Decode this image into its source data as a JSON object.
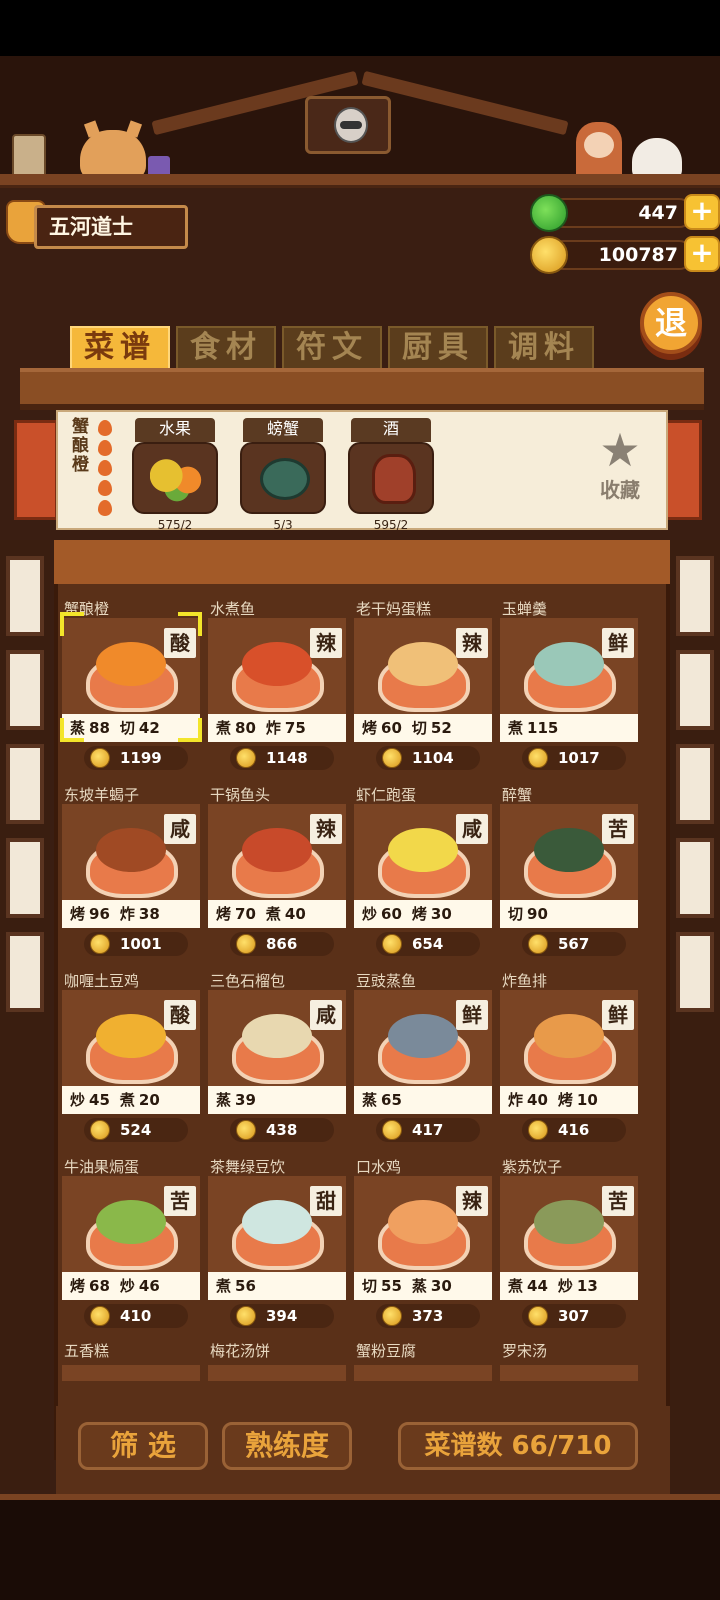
{
  "player": {
    "name": "五河道士"
  },
  "currency": {
    "gems": "447",
    "coins": "100787",
    "plus": "+"
  },
  "exit_label": "退",
  "tabs": [
    {
      "label": "菜谱",
      "active": true
    },
    {
      "label": "食材",
      "active": false
    },
    {
      "label": "符文",
      "active": false
    },
    {
      "label": "厨具",
      "active": false
    },
    {
      "label": "调料",
      "active": false
    }
  ],
  "selected_dish": {
    "name": "蟹酿橙",
    "ingredients": [
      {
        "label": "水果",
        "count": "575/2",
        "icon": "fruit-icon"
      },
      {
        "label": "螃蟹",
        "count": "5/3",
        "icon": "crab-icon"
      },
      {
        "label": "酒",
        "count": "595/2",
        "icon": "wine-jar-icon"
      }
    ],
    "favorite_label": "收藏",
    "favorite_icon": "star-icon"
  },
  "recipes": [
    {
      "name": "蟹酿橙",
      "taste": "酸",
      "skills": [
        [
          "蒸",
          "88"
        ],
        [
          "切",
          "42"
        ]
      ],
      "price": "1199",
      "color": "#f08a2a"
    },
    {
      "name": "水煮鱼",
      "taste": "辣",
      "skills": [
        [
          "煮",
          "80"
        ],
        [
          "炸",
          "75"
        ]
      ],
      "price": "1148",
      "color": "#d8502a"
    },
    {
      "name": "老干妈蛋糕",
      "taste": "辣",
      "skills": [
        [
          "烤",
          "60"
        ],
        [
          "切",
          "52"
        ]
      ],
      "price": "1104",
      "color": "#f0c078"
    },
    {
      "name": "玉蝉羹",
      "taste": "鲜",
      "skills": [
        [
          "煮",
          "115"
        ]
      ],
      "price": "1017",
      "color": "#9ac8b8"
    },
    {
      "name": "东坡羊蝎子",
      "taste": "咸",
      "skills": [
        [
          "烤",
          "96"
        ],
        [
          "炸",
          "38"
        ]
      ],
      "price": "1001",
      "color": "#a04a24"
    },
    {
      "name": "干锅鱼头",
      "taste": "辣",
      "skills": [
        [
          "烤",
          "70"
        ],
        [
          "煮",
          "40"
        ]
      ],
      "price": "866",
      "color": "#c84a2a"
    },
    {
      "name": "虾仁跑蛋",
      "taste": "咸",
      "skills": [
        [
          "炒",
          "60"
        ],
        [
          "烤",
          "30"
        ]
      ],
      "price": "654",
      "color": "#f2d84a"
    },
    {
      "name": "醉蟹",
      "taste": "苦",
      "skills": [
        [
          "切",
          "90"
        ]
      ],
      "price": "567",
      "color": "#3a5a3a"
    },
    {
      "name": "咖喱土豆鸡",
      "taste": "酸",
      "skills": [
        [
          "炒",
          "45"
        ],
        [
          "煮",
          "20"
        ]
      ],
      "price": "524",
      "color": "#f0b030"
    },
    {
      "name": "三色石榴包",
      "taste": "咸",
      "skills": [
        [
          "蒸",
          "39"
        ]
      ],
      "price": "438",
      "color": "#e8d8b0"
    },
    {
      "name": "豆豉蒸鱼",
      "taste": "鲜",
      "skills": [
        [
          "蒸",
          "65"
        ]
      ],
      "price": "417",
      "color": "#7a8a9a"
    },
    {
      "name": "炸鱼排",
      "taste": "鲜",
      "skills": [
        [
          "炸",
          "40"
        ],
        [
          "烤",
          "10"
        ]
      ],
      "price": "416",
      "color": "#e89a4a"
    },
    {
      "name": "牛油果焗蛋",
      "taste": "苦",
      "skills": [
        [
          "烤",
          "68"
        ],
        [
          "炒",
          "46"
        ]
      ],
      "price": "410",
      "color": "#8ab84a"
    },
    {
      "name": "茶舞绿豆饮",
      "taste": "甜",
      "skills": [
        [
          "煮",
          "56"
        ]
      ],
      "price": "394",
      "color": "#cfe6e0"
    },
    {
      "name": "口水鸡",
      "taste": "辣",
      "skills": [
        [
          "切",
          "55"
        ],
        [
          "蒸",
          "30"
        ]
      ],
      "price": "373",
      "color": "#f0a060"
    },
    {
      "name": "紫苏饮子",
      "taste": "苦",
      "skills": [
        [
          "煮",
          "44"
        ],
        [
          "炒",
          "13"
        ]
      ],
      "price": "307",
      "color": "#8a9a5a"
    }
  ],
  "partial_recipes": [
    "五香糕",
    "梅花汤饼",
    "蟹粉豆腐",
    "罗宋汤"
  ],
  "bottom": {
    "filter_label": "筛 选",
    "mastery_label": "熟练度",
    "recipe_count": "菜谱数 66/710"
  }
}
